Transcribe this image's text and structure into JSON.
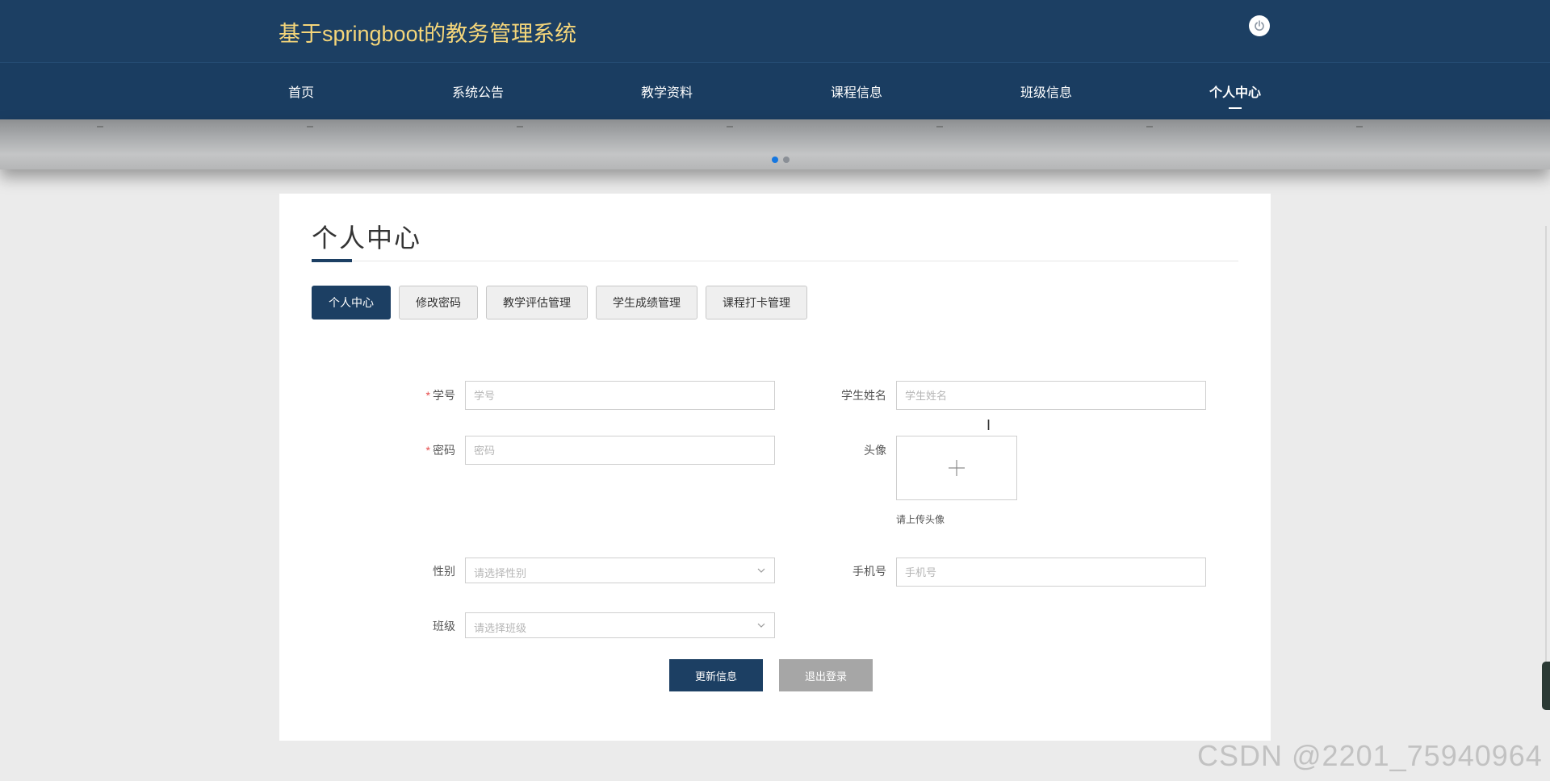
{
  "header": {
    "site_title": "基于springboot的教务管理系统",
    "power_icon": "power-icon"
  },
  "nav": {
    "items": [
      {
        "label": "首页"
      },
      {
        "label": "系统公告"
      },
      {
        "label": "教学资料"
      },
      {
        "label": "课程信息"
      },
      {
        "label": "班级信息"
      },
      {
        "label": "个人中心",
        "active": true
      }
    ]
  },
  "banner": {
    "slide_count": 2,
    "active_slide": 1
  },
  "page": {
    "title": "个人中心",
    "tabs": [
      {
        "label": "个人中心",
        "active": true
      },
      {
        "label": "修改密码"
      },
      {
        "label": "教学评估管理"
      },
      {
        "label": "学生成绩管理"
      },
      {
        "label": "课程打卡管理"
      }
    ]
  },
  "form": {
    "student_no": {
      "label": "学号",
      "required": "*",
      "placeholder": "学号",
      "value": ""
    },
    "student_name": {
      "label": "学生姓名",
      "placeholder": "学生姓名",
      "value": ""
    },
    "password": {
      "label": "密码",
      "required": "*",
      "placeholder": "密码",
      "value": ""
    },
    "avatar": {
      "label": "头像",
      "tip": "请上传头像",
      "icon": "plus-icon"
    },
    "gender": {
      "label": "性别",
      "placeholder": "请选择性别"
    },
    "phone": {
      "label": "手机号",
      "placeholder": "手机号",
      "value": ""
    },
    "class": {
      "label": "班级",
      "placeholder": "请选择班级"
    },
    "update_button": "更新信息",
    "logout_button": "退出登录"
  },
  "watermark": "CSDN @2201_75940964",
  "colors": {
    "header_bg": "#1c3f63",
    "title_color": "#f5d67a",
    "primary": "#1c3f63",
    "active_dot": "#1677e0"
  }
}
